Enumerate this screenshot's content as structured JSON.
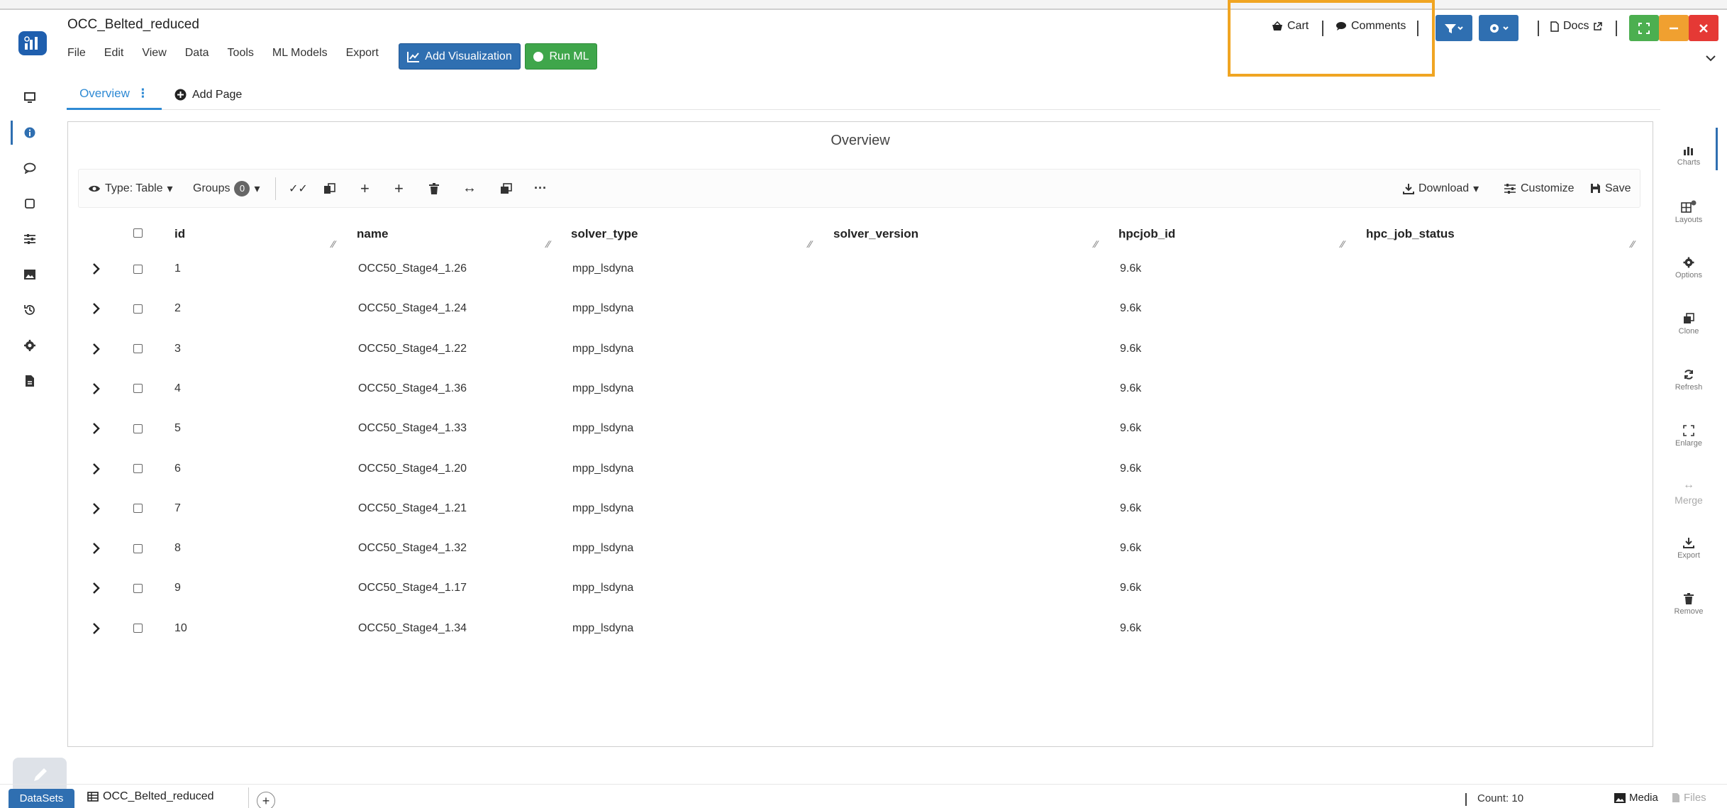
{
  "window": {
    "title": "OCC_Belted_reduced"
  },
  "menu": [
    "File",
    "Edit",
    "View",
    "Data",
    "Tools",
    "ML Models",
    "Export"
  ],
  "actions": {
    "add_visualization": "Add Visualization",
    "run_ml": "Run ML"
  },
  "topbar": {
    "cart": "Cart",
    "comments": "Comments",
    "docs": "Docs"
  },
  "tabs": {
    "overview": "Overview",
    "add_page": "Add Page"
  },
  "panel": {
    "title": "Overview"
  },
  "toolbar": {
    "type_label": "Type: Table",
    "groups_label": "Groups",
    "groups_count": "0",
    "download": "Download",
    "customize": "Customize",
    "save": "Save"
  },
  "table": {
    "columns": [
      "id",
      "name",
      "solver_type",
      "solver_version",
      "hpcjob_id",
      "hpc_job_status"
    ],
    "rows": [
      [
        "1",
        "OCC50_Stage4_1.26",
        "mpp_lsdyna",
        "",
        "9.6k",
        ""
      ],
      [
        "2",
        "OCC50_Stage4_1.24",
        "mpp_lsdyna",
        "",
        "9.6k",
        ""
      ],
      [
        "3",
        "OCC50_Stage4_1.22",
        "mpp_lsdyna",
        "",
        "9.6k",
        ""
      ],
      [
        "4",
        "OCC50_Stage4_1.36",
        "mpp_lsdyna",
        "",
        "9.6k",
        ""
      ],
      [
        "5",
        "OCC50_Stage4_1.33",
        "mpp_lsdyna",
        "",
        "9.6k",
        ""
      ],
      [
        "6",
        "OCC50_Stage4_1.20",
        "mpp_lsdyna",
        "",
        "9.6k",
        ""
      ],
      [
        "7",
        "OCC50_Stage4_1.21",
        "mpp_lsdyna",
        "",
        "9.6k",
        ""
      ],
      [
        "8",
        "OCC50_Stage4_1.32",
        "mpp_lsdyna",
        "",
        "9.6k",
        ""
      ],
      [
        "9",
        "OCC50_Stage4_1.17",
        "mpp_lsdyna",
        "",
        "9.6k",
        ""
      ],
      [
        "10",
        "OCC50_Stage4_1.34",
        "mpp_lsdyna",
        "",
        "9.6k",
        ""
      ]
    ]
  },
  "rightbar": [
    "Charts",
    "Layouts",
    "Options",
    "Clone",
    "Refresh",
    "Enlarge",
    "Merge",
    "Export",
    "Remove"
  ],
  "footer": {
    "datasets_tab": "DataSets",
    "dataset_name": "OCC_Belted_reduced",
    "count": "Count: 10",
    "media": "Media",
    "files": "Files"
  },
  "colors": {
    "primary": "#2f6fb1",
    "run_ml": "#3fa64b",
    "highlight": "#f0a522",
    "tab_active": "#2f8ad4",
    "window_green": "#4caf50",
    "window_orange": "#f0a030",
    "window_red": "#e53935"
  }
}
